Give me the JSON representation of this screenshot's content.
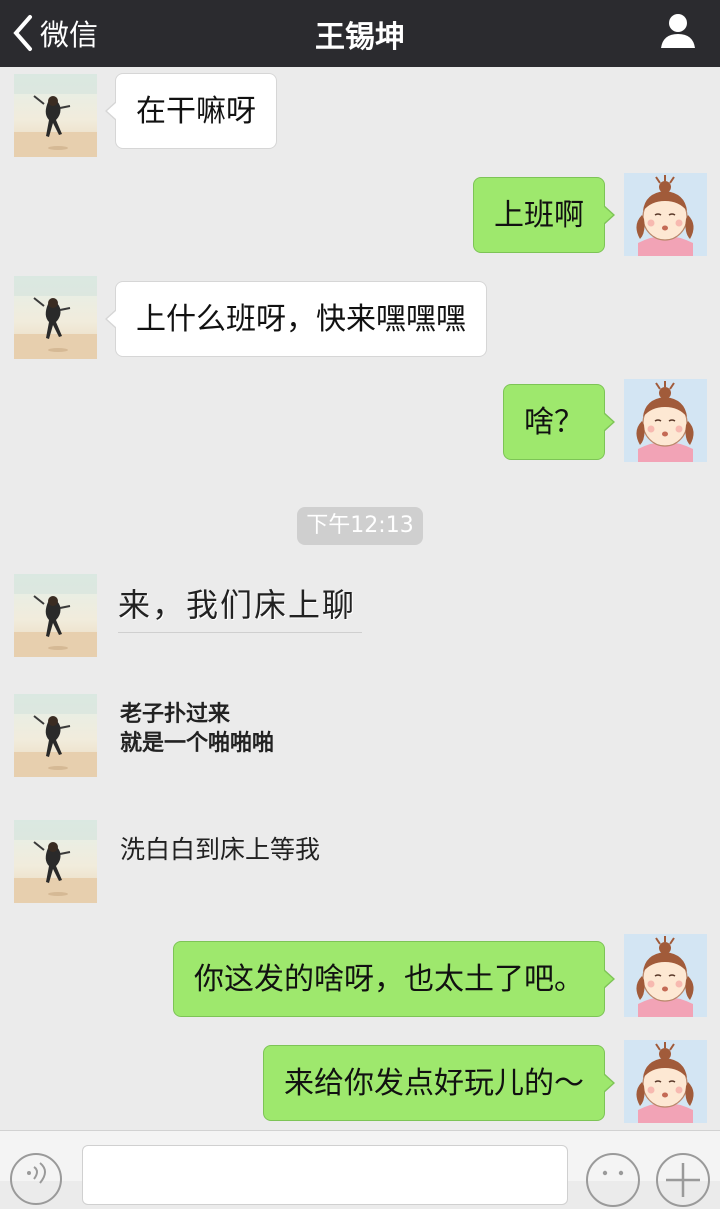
{
  "header": {
    "back_label": "微信",
    "title": "王锡坤"
  },
  "messages": [
    {
      "side": "left",
      "text": "在干嘛呀"
    },
    {
      "side": "right",
      "text": "上班啊"
    },
    {
      "side": "left",
      "text": "上什么班呀，快来嘿嘿嘿"
    },
    {
      "side": "right",
      "text": "啥？"
    }
  ],
  "timestamp": "下午12:13",
  "stickers": {
    "s1": "来，我们床上聊",
    "s2_line1": "老子扑过来",
    "s2_line2": "就是一个啪啪啪",
    "s3": "洗白白到床上等我"
  },
  "later_messages": [
    {
      "side": "right",
      "text": "你这发的啥呀，也太土了吧。"
    },
    {
      "side": "right",
      "text": "来给你发点好玩儿的～"
    }
  ],
  "input": {
    "placeholder": ""
  },
  "icons": {
    "back": "chevron-left-icon",
    "profile": "person-icon",
    "voice": "voice-icon",
    "emoji": "emoji-icon",
    "plus": "plus-icon"
  },
  "colors": {
    "topbar": "#2b2b2f",
    "background": "#ebebeb",
    "sent_bubble": "#9ee86d",
    "received_bubble": "#ffffff"
  }
}
